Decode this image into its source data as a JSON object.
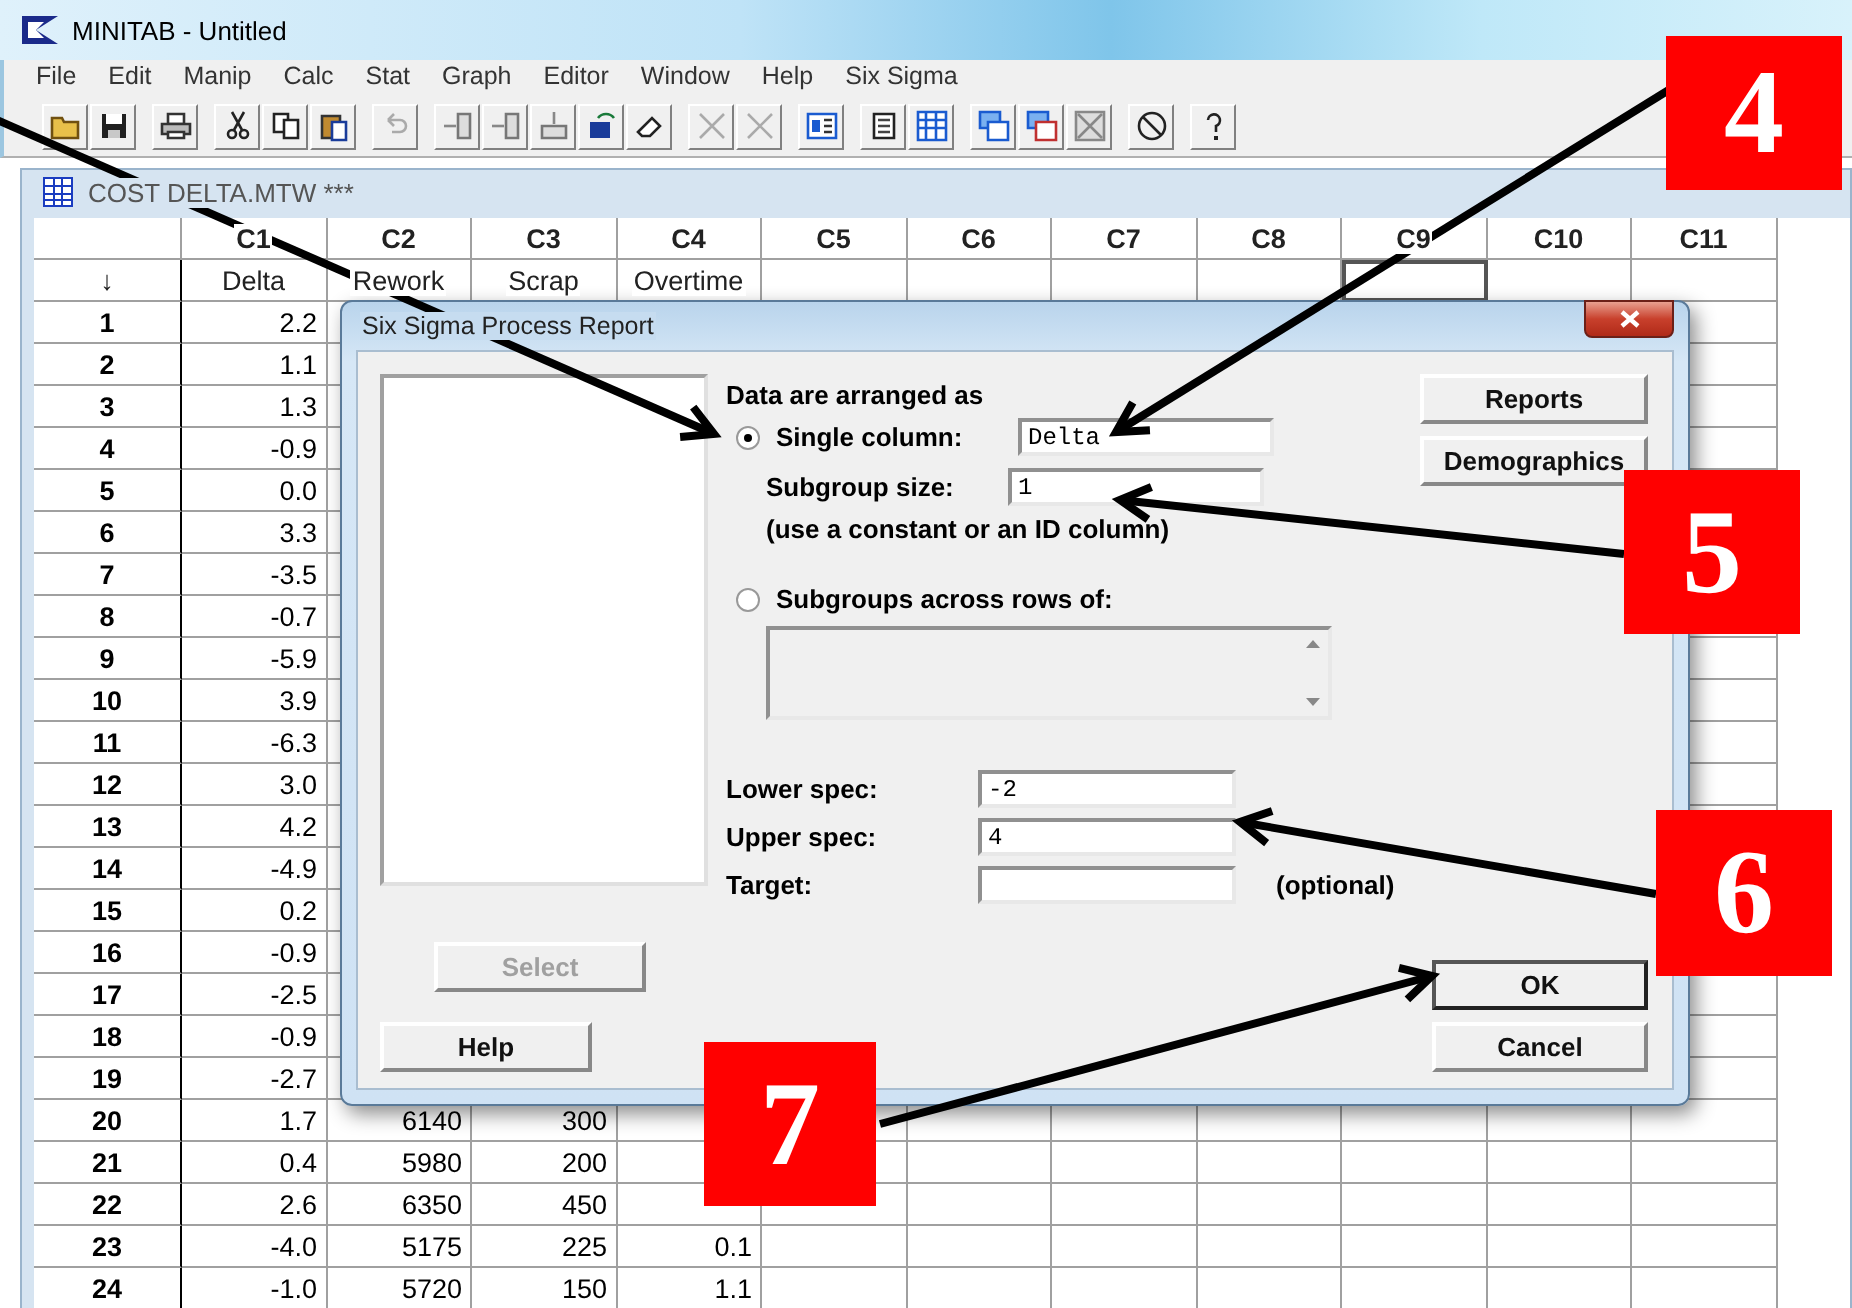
{
  "window": {
    "title": "MINITAB - Untitled"
  },
  "menu": [
    "File",
    "Edit",
    "Manip",
    "Calc",
    "Stat",
    "Graph",
    "Editor",
    "Window",
    "Help",
    "Six Sigma"
  ],
  "worksheet": {
    "title": "COST DELTA.MTW ***",
    "sort_marker": "↓",
    "columns": [
      {
        "id": "C1",
        "name": "Delta",
        "selected": false
      },
      {
        "id": "C2",
        "name": "Rework",
        "selected": false
      },
      {
        "id": "C3",
        "name": "Scrap",
        "selected": false
      },
      {
        "id": "C4",
        "name": "Overtime",
        "selected": false
      },
      {
        "id": "C5",
        "selected": false
      },
      {
        "id": "C6",
        "selected": false
      },
      {
        "id": "C7",
        "selected": false
      },
      {
        "id": "C8",
        "selected": false
      },
      {
        "id": "C9",
        "selected": true
      },
      {
        "id": "C10",
        "selected": false
      },
      {
        "id": "C11",
        "selected": false
      }
    ],
    "rows": [
      {
        "number": "1",
        "cells": [
          "2.2"
        ]
      },
      {
        "number": "2",
        "cells": [
          "1.1"
        ]
      },
      {
        "number": "3",
        "cells": [
          "1.3"
        ]
      },
      {
        "number": "4",
        "cells": [
          "-0.9"
        ]
      },
      {
        "number": "5",
        "cells": [
          "0.0"
        ]
      },
      {
        "number": "6",
        "cells": [
          "3.3"
        ]
      },
      {
        "number": "7",
        "cells": [
          "-3.5"
        ]
      },
      {
        "number": "8",
        "cells": [
          "-0.7"
        ]
      },
      {
        "number": "9",
        "cells": [
          "-5.9"
        ]
      },
      {
        "number": "10",
        "cells": [
          "3.9"
        ]
      },
      {
        "number": "11",
        "cells": [
          "-6.3"
        ]
      },
      {
        "number": "12",
        "cells": [
          "3.0"
        ]
      },
      {
        "number": "13",
        "cells": [
          "4.2"
        ]
      },
      {
        "number": "14",
        "cells": [
          "-4.9"
        ]
      },
      {
        "number": "15",
        "cells": [
          "0.2"
        ]
      },
      {
        "number": "16",
        "cells": [
          "-0.9"
        ]
      },
      {
        "number": "17",
        "cells": [
          "-2.5"
        ]
      },
      {
        "number": "18",
        "cells": [
          "-0.9"
        ]
      },
      {
        "number": "19",
        "cells": [
          "-2.7"
        ]
      },
      {
        "number": "20",
        "cells": [
          "1.7",
          "6140",
          "300"
        ]
      },
      {
        "number": "21",
        "cells": [
          "0.4",
          "5980",
          "200"
        ]
      },
      {
        "number": "22",
        "cells": [
          "2.6",
          "6350",
          "450"
        ]
      },
      {
        "number": "23",
        "cells": [
          "-4.0",
          "5175",
          "225",
          "0.1"
        ]
      },
      {
        "number": "24",
        "cells": [
          "-1.0",
          "5720",
          "150",
          "1.1"
        ]
      }
    ]
  },
  "dialog": {
    "title": "Six Sigma Process Report",
    "arrangement_label": "Data are arranged as",
    "options": [
      {
        "label": "Single column:",
        "selected": true
      },
      {
        "label": "Subgroups across rows of:",
        "selected": false
      }
    ],
    "single_column_value": "Delta",
    "subgroup_size": {
      "label": "Subgroup size:",
      "value": "1"
    },
    "hint": "(use a constant or an ID column)",
    "specs": [
      {
        "label": "Lower spec:",
        "value": "-2"
      },
      {
        "label": "Upper spec:",
        "value": "4"
      },
      {
        "label": "Target:",
        "note": "(optional)"
      }
    ],
    "buttons": [
      {
        "label": "Select",
        "disabled": true
      },
      {
        "label": "Help",
        "disabled": false
      },
      {
        "label": "Reports",
        "disabled": false
      },
      {
        "label": "Demographics",
        "disabled": false
      },
      {
        "label": "OK",
        "disabled": false
      },
      {
        "label": "Cancel",
        "disabled": false
      }
    ]
  },
  "callouts": [
    {
      "label": "4"
    },
    {
      "label": "5"
    },
    {
      "label": "6"
    },
    {
      "label": "7"
    }
  ]
}
